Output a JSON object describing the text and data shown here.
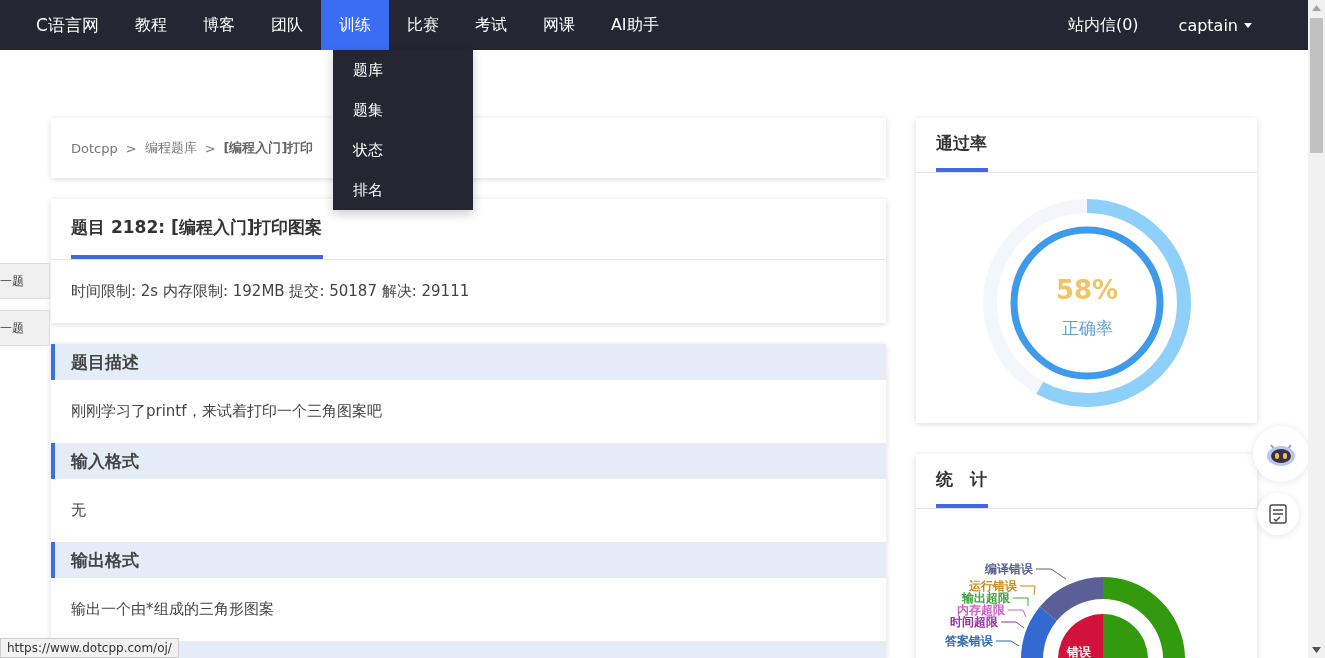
{
  "nav": {
    "logo": "C语言网",
    "items": [
      {
        "label": "教程",
        "selected": false
      },
      {
        "label": "博客",
        "selected": false
      },
      {
        "label": "团队",
        "selected": false
      },
      {
        "label": "训练",
        "selected": true
      },
      {
        "label": "比赛",
        "selected": false
      },
      {
        "label": "考试",
        "selected": false
      },
      {
        "label": "网课",
        "selected": false
      },
      {
        "label": "AI助手",
        "selected": false
      }
    ],
    "dropdown": [
      "题库",
      "题集",
      "状态",
      "排名"
    ],
    "messages": "站内信(0)",
    "user": "captain"
  },
  "side_tabs": [
    "一题",
    "一题"
  ],
  "breadcrumb": {
    "items": [
      "Dotcpp",
      "编程题库"
    ],
    "separator": ">",
    "current": "[编程入门]打印"
  },
  "problem": {
    "title": "题目 2182: [编程入门]打印图案",
    "info": "时间限制: 2s 内存限制: 192MB 提交: 50187 解决: 29111"
  },
  "sections": [
    {
      "heading": "题目描述",
      "body": "刚刚学习了printf，来试着打印一个三角图案吧"
    },
    {
      "heading": "输入格式",
      "body": "无"
    },
    {
      "heading": "输出格式",
      "body": "输出一个由*组成的三角形图案"
    }
  ],
  "pass_rate": {
    "title": "通过率",
    "level": 0.58,
    "percent": "58%",
    "caption": "正确率"
  },
  "stats": {
    "title": "统　计",
    "labels": [
      {
        "text": "编译错误",
        "color": "#5b5f8f"
      },
      {
        "text": "运行错误",
        "color": "#d08a12"
      },
      {
        "text": "输出超限",
        "color": "#3fa33f"
      },
      {
        "text": "内存超限",
        "color": "#d060c8"
      },
      {
        "text": "时间超限",
        "color": "#9a2fae"
      },
      {
        "text": "答案错误",
        "color": "#2e6bb5"
      }
    ],
    "inner_label": "错误"
  },
  "status_url": "https://www.dotcpp.com/oj/"
}
